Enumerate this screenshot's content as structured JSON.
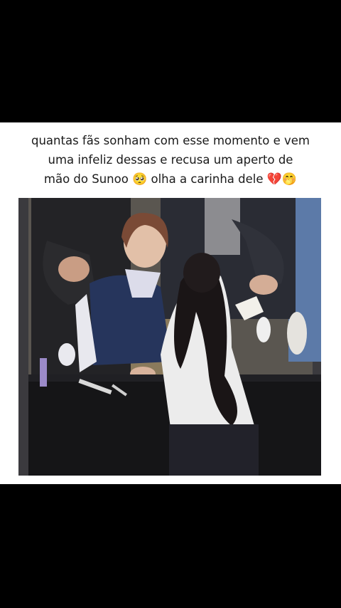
{
  "post": {
    "caption_line1": "quantas fãs sonham com esse momento e vem",
    "caption_line2": "uma infeliz dessas e recusa um aperto de",
    "caption_line3_prefix": "mão do Sunoo",
    "caption_emoji_1": "🥺",
    "caption_line3_middle": "olha a carinha dele",
    "caption_emoji_2": "💔🤭"
  },
  "colors": {
    "background": "#000000",
    "post_background": "#ffffff",
    "caption_text": "#1a1a1a"
  }
}
